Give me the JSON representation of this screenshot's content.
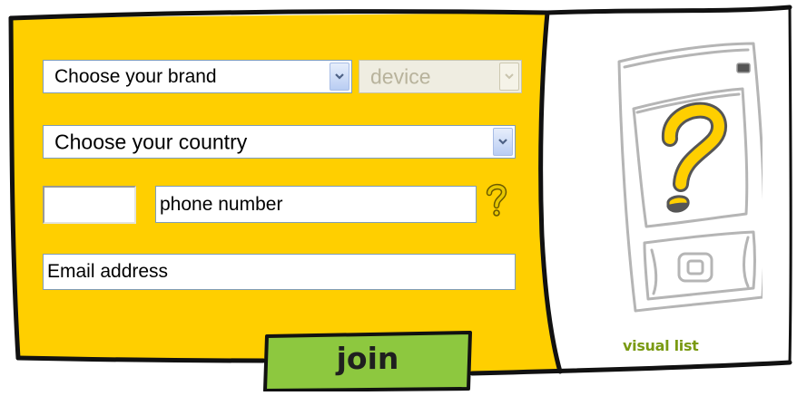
{
  "form": {
    "brand_select": {
      "value": "Choose your brand"
    },
    "device_select": {
      "value": "device",
      "disabled": true
    },
    "country_select": {
      "value": "Choose your country"
    },
    "area_code_input": {
      "value": ""
    },
    "phone_input": {
      "value": "phone number"
    },
    "email_input": {
      "value": "Email address"
    },
    "help_icon": "question-mark-icon",
    "join_button": {
      "label": "join"
    }
  },
  "side_panel": {
    "visual_list_label": "visual list",
    "illustration_icon": "mobile-phone-question-icon"
  },
  "colors": {
    "panel_yellow": "#ffcf00",
    "join_green": "#8dc83f",
    "visual_list_green": "#7a9a12",
    "outline_dark": "#111111"
  }
}
